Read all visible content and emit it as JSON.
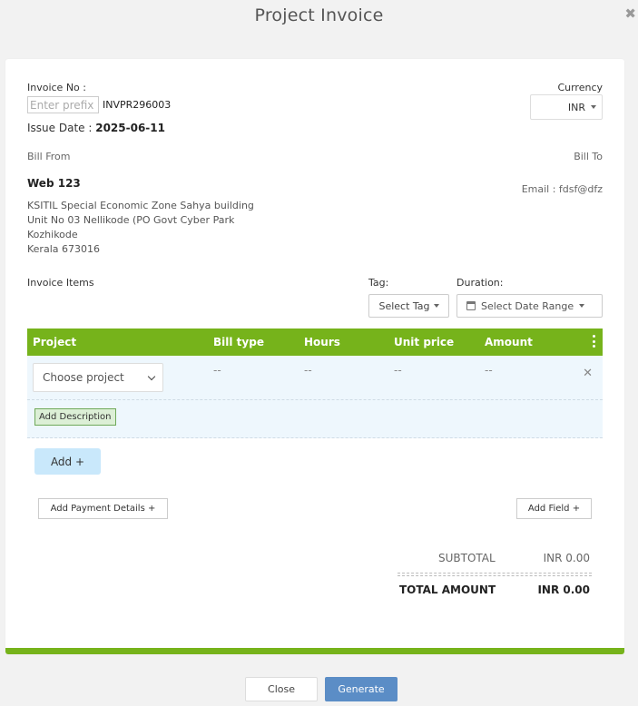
{
  "modal": {
    "title": "Project Invoice",
    "close_icon": "close-icon"
  },
  "invoice": {
    "number_label": "Invoice No :",
    "prefix_placeholder": "Enter prefix",
    "number_value": "INVPR296003",
    "issue_label": "Issue Date :",
    "issue_date": "2025-06-11",
    "currency_label": "Currency",
    "currency_value": "INR"
  },
  "bill_from": {
    "label": "Bill From",
    "name": "Web 123",
    "address": [
      "KSITIL Special Economic Zone Sahya building",
      "Unit No 03 Nellikode (PO Govt Cyber Park",
      "Kozhikode",
      "Kerala 673016"
    ]
  },
  "bill_to": {
    "label": "Bill To",
    "email": "Email : fdsf@dfz"
  },
  "items": {
    "label": "Invoice Items",
    "tag_label": "Tag:",
    "tag_select": "Select Tag",
    "duration_label": "Duration:",
    "duration_select": "Select Date Range",
    "columns": [
      "Project",
      "Bill type",
      "Hours",
      "Unit price",
      "Amount"
    ],
    "row": {
      "project_placeholder": "Choose project",
      "bill_type": "--",
      "hours": "--",
      "unit_price": "--",
      "amount": "--"
    },
    "add_description": "Add Description",
    "add_button": "Add +"
  },
  "extras": {
    "payment_details": "Add Payment Details +",
    "add_field": "Add Field +"
  },
  "totals": {
    "subtotal_label": "SUBTOTAL",
    "subtotal_value": "INR 0.00",
    "total_label": "TOTAL AMOUNT",
    "total_value": "INR 0.00"
  },
  "footer": {
    "close": "Close",
    "generate": "Generate"
  },
  "colors": {
    "accent_green": "#76b31b",
    "primary_blue": "#5b8dc6",
    "row_bg": "#eef7fd"
  }
}
